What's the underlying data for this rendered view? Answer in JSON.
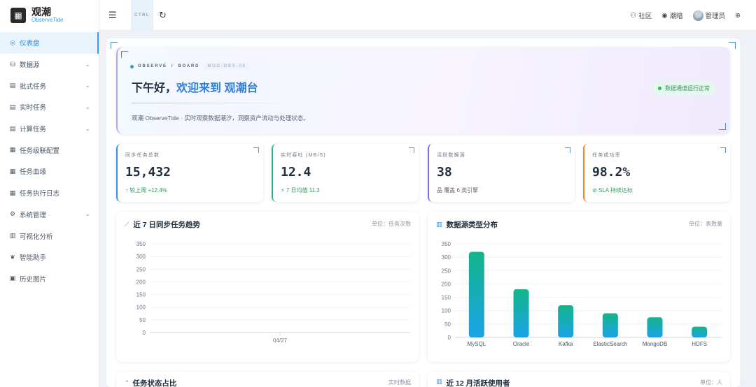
{
  "brand": {
    "title": "观潮",
    "subtitle": "ObserveTide"
  },
  "sidebar": {
    "items": [
      {
        "icon": "◎",
        "label": "仪表盘",
        "expandable": false,
        "active": true
      },
      {
        "icon": "⛁",
        "label": "数据源",
        "expandable": true
      },
      {
        "icon": "▤",
        "label": "批式任务",
        "expandable": true
      },
      {
        "icon": "▤",
        "label": "实时任务",
        "expandable": true
      },
      {
        "icon": "▤",
        "label": "计算任务",
        "expandable": true
      },
      {
        "icon": "▦",
        "label": "任务级联配置",
        "expandable": false
      },
      {
        "icon": "▦",
        "label": "任务血缘",
        "expandable": false
      },
      {
        "icon": "▦",
        "label": "任务执行日志",
        "expandable": false
      },
      {
        "icon": "⚙",
        "label": "系统管理",
        "expandable": true
      },
      {
        "icon": "▥",
        "label": "可视化分析",
        "expandable": false
      },
      {
        "icon": "❦",
        "label": "智能助手",
        "expandable": false
      },
      {
        "icon": "▣",
        "label": "历史图片",
        "expandable": false
      }
    ]
  },
  "header": {
    "ctrl_label": "CTRL",
    "community": "社区",
    "theme": "潮暗",
    "user": "管理员"
  },
  "banner": {
    "crumb_a": "OBSERVE",
    "crumb_sep": "/",
    "crumb_b": "BOARD",
    "code": "MOD-OBS-08",
    "greeting_prefix": "下午好，",
    "greeting_highlight": "欢迎来到 观潮台",
    "description": "观潮 ObserveTide · 实时观察数据潮汐，洞察资产流动与处理状态。",
    "status": "数据通道运行正常"
  },
  "stats": [
    {
      "label": "同步任务总数",
      "value": "15,432",
      "sub": "↑ 较上周 +12.4%",
      "accent": "#3d8fe0",
      "sub_color": "#2f9a5c"
    },
    {
      "label": "实时吞吐 (MB/S)",
      "value": "12.4",
      "sub": "⚡ 7 日均值 11.3",
      "accent": "#2fb37c",
      "sub_color": "#2f9a5c"
    },
    {
      "label": "活跃数据源",
      "value": "38",
      "sub": "品 覆盖 6 类引擎",
      "accent": "#7b6be6",
      "sub_color": "#5a6573"
    },
    {
      "label": "任务成功率",
      "value": "98.2%",
      "sub": "⊘ SLA 持续达标",
      "accent": "#f0862e",
      "sub_color": "#2f9a5c"
    }
  ],
  "trend_chart": {
    "title": "近 7 日同步任务趋势",
    "unit": "单位：任务次数",
    "icon": "trend-icon"
  },
  "source_chart": {
    "title": "数据源类型分布",
    "unit": "单位：表数量",
    "icon": "bar-chart-icon"
  },
  "bottom_cards": [
    {
      "title": "任务状态占比",
      "unit": "实时数据"
    },
    {
      "title": "近 12 月活跃使用者",
      "unit": "单位：人"
    }
  ],
  "chart_data": [
    {
      "type": "line",
      "title": "近 7 日同步任务趋势",
      "categories": [
        "04/27"
      ],
      "series": [],
      "ylim": [
        0,
        350
      ],
      "yticks": [
        0,
        50,
        100,
        150,
        200,
        250,
        300,
        350
      ],
      "grid": true
    },
    {
      "type": "bar",
      "title": "数据源类型分布",
      "categories": [
        "MySQL",
        "Oracle",
        "Kafka",
        "ElasticSearch",
        "MongoDB",
        "HDFS"
      ],
      "values": [
        320,
        180,
        120,
        90,
        75,
        40
      ],
      "ylim": [
        0,
        350
      ],
      "yticks": [
        0,
        50,
        100,
        150,
        200,
        250,
        300,
        350
      ],
      "grid": true,
      "colors": [
        "#13b58a",
        "#1aa3e8"
      ]
    }
  ]
}
